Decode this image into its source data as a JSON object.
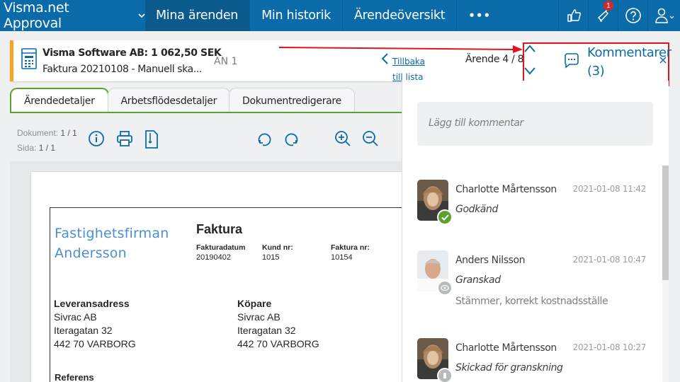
{
  "nav": {
    "brand": "Visma.net Approval",
    "tabs": [
      "Mina ärenden",
      "Min historik",
      "Ärendeöversikt"
    ],
    "more": "•••",
    "notification_count": "1"
  },
  "header": {
    "title": "Visma Software AB: 1 062,50 SEK",
    "subtitle": "Faktura 20210108 - Manuell ska...",
    "an": "AN 1",
    "back_label": "Tillbaka till lista",
    "counter": "Ärende 4 / 8"
  },
  "comments_panel": {
    "title": "Kommentarer (3)",
    "add_placeholder": "Lägg till kommentar",
    "items": [
      {
        "name": "Charlotte Mårtensson",
        "date": "2021-01-08 11:42",
        "status": "Godkänd",
        "text": "",
        "status_color": "#5aa130"
      },
      {
        "name": "Anders Nilsson",
        "date": "2021-01-08 10:47",
        "status": "Granskad",
        "text": "Stämmer, korrekt kostnadsställe",
        "status_color": "#b8bbbe"
      },
      {
        "name": "Charlotte Mårtensson",
        "date": "2021-01-08 10:27",
        "status": "Skickad för granskning",
        "text": "",
        "status_color": "#b8bbbe"
      }
    ]
  },
  "tabs": [
    "Ärendedetaljer",
    "Arbetsflödesdetaljer",
    "Dokumentredigerare"
  ],
  "docinfo": {
    "dokument_label": "Dokument:",
    "dokument_value": "1 / 1",
    "sida_label": "Sida:",
    "sida_value": "1 / 1"
  },
  "invoice": {
    "company_line1": "Fastighetsfirman",
    "company_line2": "Andersson",
    "title": "Faktura",
    "fakturadatum_label": "Fakturadatum",
    "fakturadatum": "20190402",
    "kund_label": "Kund nr:",
    "kund": "1015",
    "faktura_label": "Faktura nr:",
    "faktura": "10154",
    "delivery": {
      "heading": "Leveransadress",
      "line1": "Sivrac AB",
      "line2": "Iteragatan 32",
      "line3": "442 70 VARBORG"
    },
    "buyer": {
      "heading": "Köpare",
      "line1": "Sivrac AB",
      "line2": "Iteragatan 32",
      "line3": "442 70 VARBORG"
    },
    "reference_cut": "Referens"
  },
  "colors": {
    "brand": "#0b6ba8",
    "accent_green": "#5aa130",
    "annotation_red": "#e0141c",
    "header_orange": "#f6a623"
  }
}
